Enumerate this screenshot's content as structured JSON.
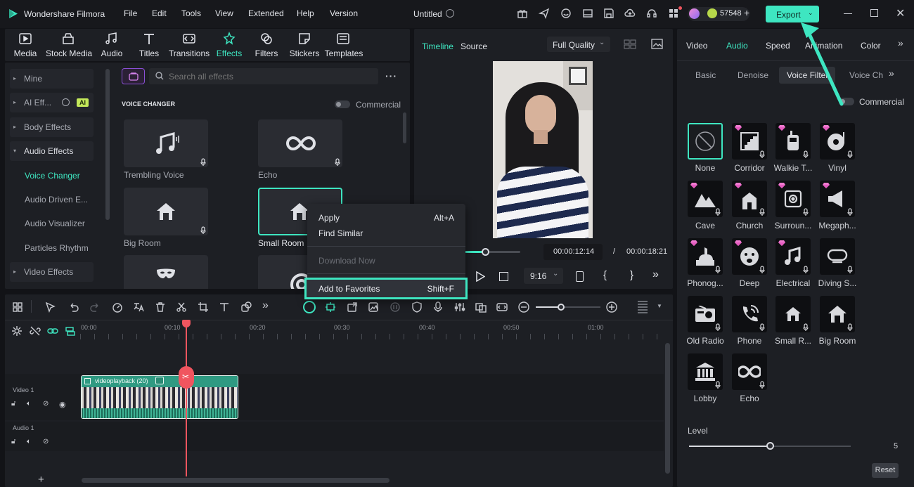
{
  "app": {
    "name": "Wondershare Filmora",
    "doc_title": "Untitled",
    "credits": "57548",
    "export_label": "Export"
  },
  "menu": [
    "File",
    "Edit",
    "Tools",
    "View",
    "Extended",
    "Help",
    "Version"
  ],
  "toolbar": [
    "Media",
    "Stock Media",
    "Audio",
    "Titles",
    "Transitions",
    "Effects",
    "Filters",
    "Stickers",
    "Templates"
  ],
  "sidebar": {
    "items": [
      "Mine",
      "AI Eff...",
      "Body Effects",
      "Audio Effects"
    ],
    "ai_badge": "AI",
    "sub_items": [
      "Voice Changer",
      "Audio Driven E...",
      "Audio Visualizer",
      "Particles Rhythm"
    ],
    "video_effects": "Video Effects"
  },
  "effects": {
    "search_placeholder": "Search all effects",
    "section_title": "VOICE CHANGER",
    "commercial": "Commercial",
    "tiles": [
      "Trembling Voice",
      "Echo",
      "Big Room",
      "Small Room"
    ]
  },
  "context_menu": {
    "apply": "Apply",
    "apply_key": "Alt+A",
    "find_similar": "Find Similar",
    "download": "Download Now",
    "favorites": "Add to Favorites",
    "favorites_key": "Shift+F"
  },
  "player": {
    "tab_timeline": "Timeline",
    "tab_source": "Source",
    "quality": "Full Quality",
    "current_time": "00:00:12:14",
    "separator": "/",
    "total_time": "00:00:18:21",
    "aspect": "9:16"
  },
  "right_panel": {
    "tabs": [
      "Video",
      "Audio",
      "Speed",
      "Animation",
      "Color"
    ],
    "subtabs": [
      "Basic",
      "Denoise",
      "Voice Filter",
      "Voice Cha..."
    ],
    "commercial": "Commercial",
    "filters": [
      "None",
      "Corridor",
      "Walkie T...",
      "Vinyl",
      "Cave",
      "Church",
      "Surroun...",
      "Megaph...",
      "Phonog...",
      "Deep",
      "Electrical",
      "Diving S...",
      "Old Radio",
      "Phone",
      "Small R...",
      "Big Room",
      "Lobby",
      "Echo"
    ],
    "level_label": "Level",
    "level_value": "5",
    "level_fraction": 0.5,
    "reset": "Reset"
  },
  "timeline": {
    "ruler": [
      "00:00",
      "00:10",
      "00:20",
      "00:30",
      "00:40",
      "00:50",
      "01:00"
    ],
    "track_video": "Video 1",
    "track_audio": "Audio 1",
    "clip_name": "videoplayback (20)",
    "add_track": "+"
  },
  "colors": {
    "accent": "#3ee6c1",
    "playhead": "#f0555f",
    "clip": "#2a8a74"
  }
}
